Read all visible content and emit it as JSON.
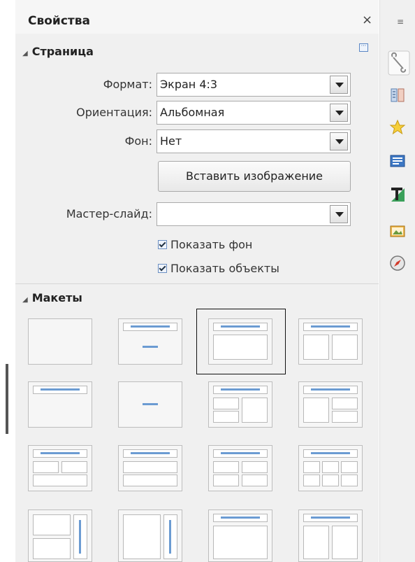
{
  "panel": {
    "title": "Свойства",
    "close_glyph": "×",
    "menu_glyph": "≡"
  },
  "page_section": {
    "heading": "Страница",
    "format_label": "Формат:",
    "format_value": "Экран 4:3",
    "orientation_label": "Ориентация:",
    "orientation_value": "Альбомная",
    "background_label": "Фон:",
    "background_value": "Нет",
    "insert_image_label": "Вставить изображение",
    "master_slide_label": "Мастер-слайд:",
    "master_slide_value": "",
    "show_background_label": "Показать фон",
    "show_objects_label": "Показать объекты"
  },
  "layouts_section": {
    "heading": "Макеты"
  },
  "sidebar_icons": [
    "wrench-properties-icon",
    "styles-icon",
    "gallery-star-icon",
    "slide-transition-icon",
    "fontwork-t-icon",
    "image-icon",
    "navigator-compass-icon"
  ],
  "colors": {
    "accent": "#6b9bd2",
    "panel_bg": "#f0f0f0"
  }
}
